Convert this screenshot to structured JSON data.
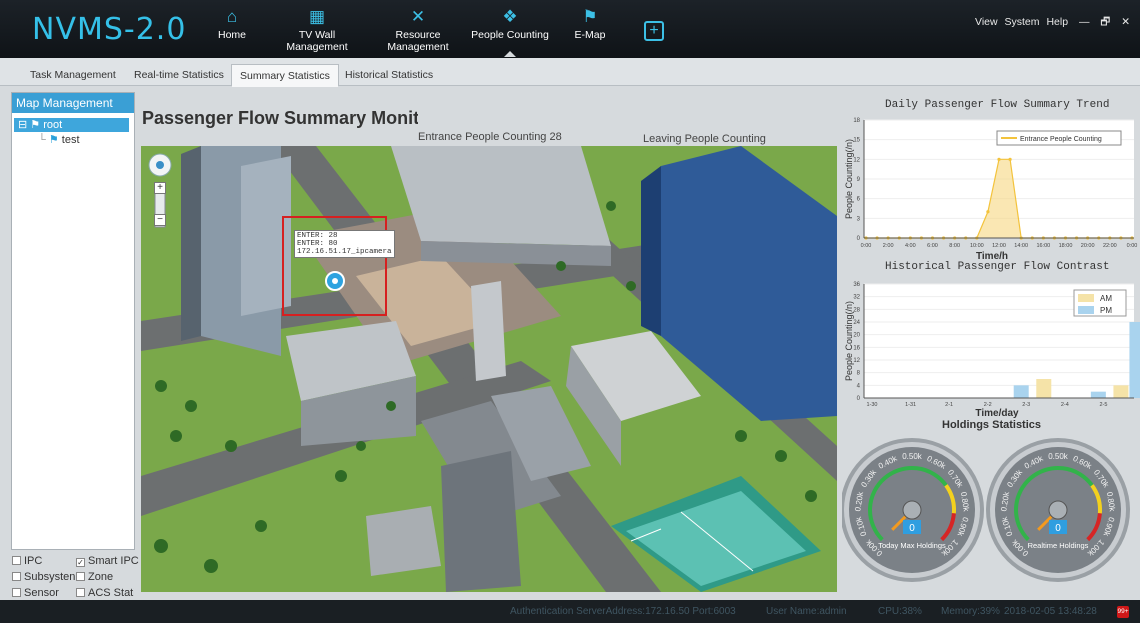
{
  "app": {
    "logo": "NVMS-2.0"
  },
  "nav": [
    {
      "label": "Home",
      "icon": "home-icon"
    },
    {
      "label": "TV Wall Management",
      "icon": "tv-wall-icon"
    },
    {
      "label": "Resource Management",
      "icon": "resource-tools-icon"
    },
    {
      "label": "People Counting",
      "icon": "people-counting-icon"
    },
    {
      "label": "E-Map",
      "icon": "flag-icon"
    }
  ],
  "window_menu": {
    "view": "View",
    "system": "System",
    "help": "Help",
    "minimize": "—",
    "restore": "🗗",
    "close": "✕"
  },
  "tabs": [
    "Task Management",
    "Real-time Statistics",
    "Summary Statistics",
    "Historical Statistics"
  ],
  "active_tab": "Summary Statistics",
  "sidebar": {
    "title": "Map Management",
    "tree": {
      "root": "root",
      "child": "test"
    },
    "filters": [
      {
        "label": "IPC",
        "checked": false
      },
      {
        "label": "Smart IPC",
        "checked": true
      },
      {
        "label": "Subsysten",
        "checked": false
      },
      {
        "label": "Zone",
        "checked": false
      },
      {
        "label": "Sensor",
        "checked": false
      },
      {
        "label": "ACS Static",
        "checked": false
      }
    ]
  },
  "main": {
    "title": "Passenger Flow Summary Monit",
    "entrance": "Entrance People Counting  28",
    "leaving": "Leaving People Counting"
  },
  "map": {
    "popup": {
      "line1": "ENTER: 28",
      "line2": "ENTER: 80",
      "line3": "172.16.51.17_ipcamera"
    },
    "zoom_in": "+",
    "zoom_out": "−"
  },
  "chart_data": [
    {
      "type": "line",
      "title": "Daily Passenger Flow Summary Trend",
      "xlabel": "Time/h",
      "ylabel": "People Counting(/n)",
      "ylim": [
        0,
        18
      ],
      "yticks": [
        0,
        3,
        6,
        9,
        12,
        15,
        18
      ],
      "x": [
        "0:00",
        "2:00",
        "4:00",
        "6:00",
        "8:00",
        "10:00",
        "12:00",
        "14:00",
        "16:00",
        "18:00",
        "20:00",
        "22:00",
        "0:00"
      ],
      "series": [
        {
          "name": "Entrance People Counting",
          "color": "#f3c33c",
          "values": [
            0,
            0,
            0,
            0,
            0,
            0,
            0,
            0,
            0,
            0,
            0,
            4,
            12,
            12,
            0,
            0,
            0,
            0,
            0,
            0,
            0,
            0,
            0,
            0,
            0
          ]
        }
      ],
      "legend": "top-right"
    },
    {
      "type": "bar",
      "title": "Historical Passenger Flow Contrast",
      "xlabel": "Time/day",
      "ylabel": "People Counting(/n)",
      "ylim": [
        0,
        36
      ],
      "yticks": [
        0,
        4,
        8,
        12,
        16,
        20,
        24,
        28,
        32,
        36
      ],
      "categories": [
        "1-30",
        "1-31",
        "2-1",
        "2-2",
        "2-3",
        "2-4",
        "2-5"
      ],
      "series": [
        {
          "name": "AM",
          "color": "#f5e3a8",
          "values": [
            0,
            0,
            0,
            0,
            6,
            0,
            4
          ]
        },
        {
          "name": "PM",
          "color": "#a9d3ee",
          "values": [
            0,
            0,
            0,
            4,
            0,
            2,
            24
          ]
        }
      ],
      "legend": "top-right"
    }
  ],
  "holdings": {
    "title": "Holdings Statistics",
    "gauges": [
      {
        "label": "Today Max Holdings",
        "value": "0",
        "fraction": 0
      },
      {
        "label": "Realtime Holdings",
        "value": "0",
        "fraction": 0
      }
    ],
    "scale": [
      "0.00k",
      "0.10k",
      "0.20k",
      "0.30k",
      "0.40k",
      "0.50k",
      "0.60k",
      "0.70k",
      "0.80k",
      "0.90k",
      "1.00k"
    ]
  },
  "status": {
    "server": "Authentication ServerAddress:172.16.50 Port:6003",
    "user": "User Name:admin",
    "cpu": "CPU:38%",
    "memory": "Memory:39%",
    "datetime": "2018-02-05 13:48:28",
    "badge": "99+"
  }
}
